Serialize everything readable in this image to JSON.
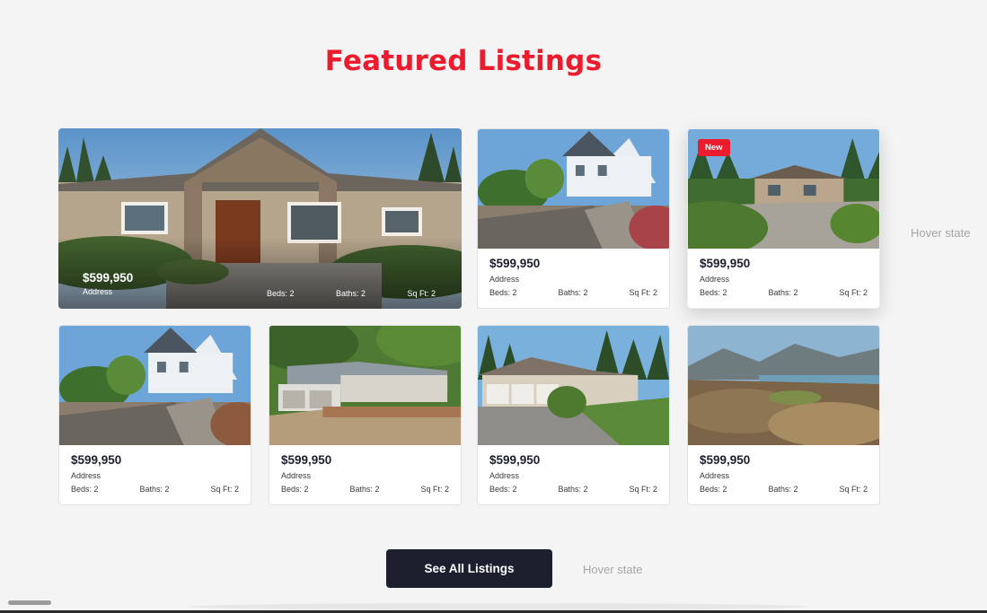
{
  "section": {
    "title": "Featured Listings"
  },
  "featured": {
    "price": "$599,950",
    "address": "Address",
    "beds": "Beds: 2",
    "baths": "Baths: 2",
    "sqft": "Sq Ft: 2"
  },
  "listings": [
    {
      "price": "$599,950",
      "address": "Address",
      "beds": "Beds: 2",
      "baths": "Baths: 2",
      "sqft": "Sq Ft: 2"
    },
    {
      "price": "$599,950",
      "address": "Address",
      "beds": "Beds: 2",
      "baths": "Baths: 2",
      "sqft": "Sq Ft: 2",
      "badge": "New"
    },
    {
      "price": "$599,950",
      "address": "Address",
      "beds": "Beds: 2",
      "baths": "Baths: 2",
      "sqft": "Sq Ft: 2"
    },
    {
      "price": "$599,950",
      "address": "Address",
      "beds": "Beds: 2",
      "baths": "Baths: 2",
      "sqft": "Sq Ft: 2"
    },
    {
      "price": "$599,950",
      "address": "Address",
      "beds": "Beds: 2",
      "baths": "Baths: 2",
      "sqft": "Sq Ft: 2"
    },
    {
      "price": "$599,950",
      "address": "Address",
      "beds": "Beds: 2",
      "baths": "Baths: 2",
      "sqft": "Sq Ft: 2"
    }
  ],
  "annotations": {
    "card_hover": "Hover state",
    "button_hover": "Hover state"
  },
  "cta": {
    "label": "See All Listings"
  },
  "colors": {
    "accent": "#ec1b2e",
    "button": "#1b1f2e",
    "background": "#f4f4f4"
  }
}
